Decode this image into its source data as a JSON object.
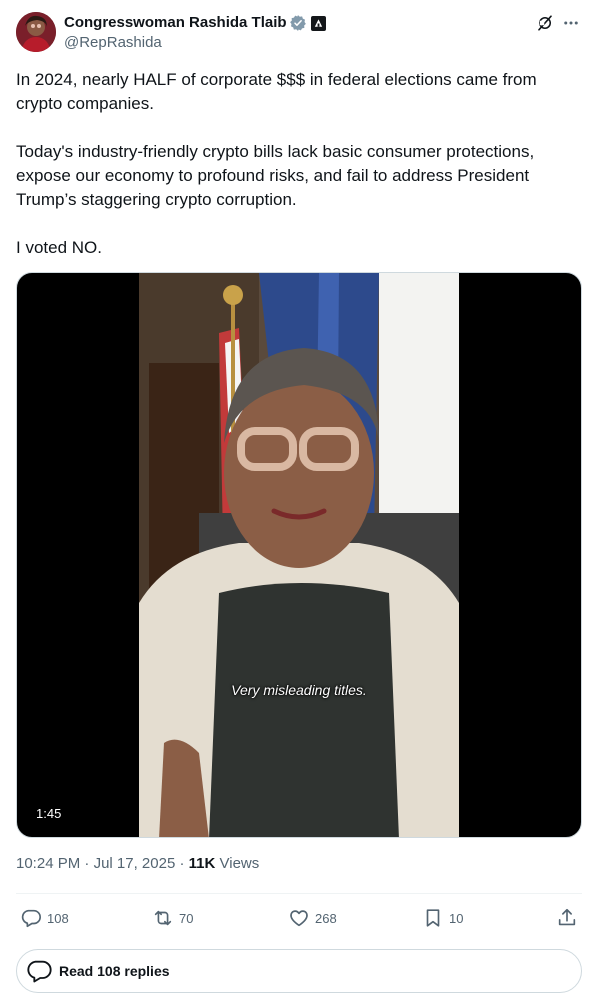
{
  "author": {
    "display_name": "Congresswoman Rashida Tlaib",
    "handle": "@RepRashida"
  },
  "tweet": {
    "text": "In 2024, nearly HALF of corporate $$$ in federal elections came from crypto companies.\n\nToday's industry-friendly crypto bills lack basic consumer protections, expose our economy to profound risks, and fail to address President Trump’s staggering crypto corruption.\n\nI voted NO."
  },
  "video": {
    "duration": "1:45",
    "caption": "Very misleading titles."
  },
  "meta": {
    "time": "10:24 PM",
    "date": "Jul 17, 2025",
    "views_count": "11K",
    "views_label": "Views"
  },
  "actions": {
    "replies": "108",
    "reposts": "70",
    "likes": "268",
    "bookmarks": "10"
  },
  "read_replies_label": "Read 108 replies",
  "colors": {
    "text": "#0f1419",
    "secondary": "#536471",
    "verified": "#829aab",
    "border": "#cfd9de"
  }
}
